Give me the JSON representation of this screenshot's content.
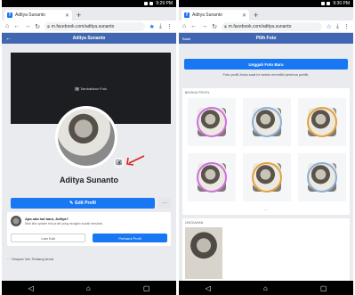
{
  "left": {
    "tab_title": "Aditya Sunanto",
    "url": "m.facebook.com/aditya.sunanto",
    "header_title": "Aditya Sunanto",
    "cover_button": "Tambahkan Foto",
    "profile_name": "Aditya Sunanto",
    "edit_profile": "Edit Profil",
    "prompt_title": "Apa ada hal baru, Aditya?",
    "prompt_sub": "Mari kita update info profil yang mungkin sudah berubah.",
    "later_button": "Lain Kali",
    "update_button": "Perbarui Profil",
    "save_info": "Simpan Info Tentang Anda",
    "status_time": "9:29 PM"
  },
  "right": {
    "tab_title": "Aditya Sunanto",
    "url": "m.facebook.com/aditya.sunanto",
    "header_title": "Pilih Foto",
    "cancel": "Batal",
    "upload_button": "Unggah Foto Baru",
    "upload_note": "Foto profil Anda saat ini selalu memiliki pemirsa publik.",
    "profile_section": "BINGKAI PROFIL",
    "uploads_section": "UNGGAHAN",
    "status_time": "9:30 PM"
  },
  "colors": {
    "fb_blue": "#4267b2",
    "button_blue": "#1877f2",
    "arrow_red": "#e02020"
  }
}
